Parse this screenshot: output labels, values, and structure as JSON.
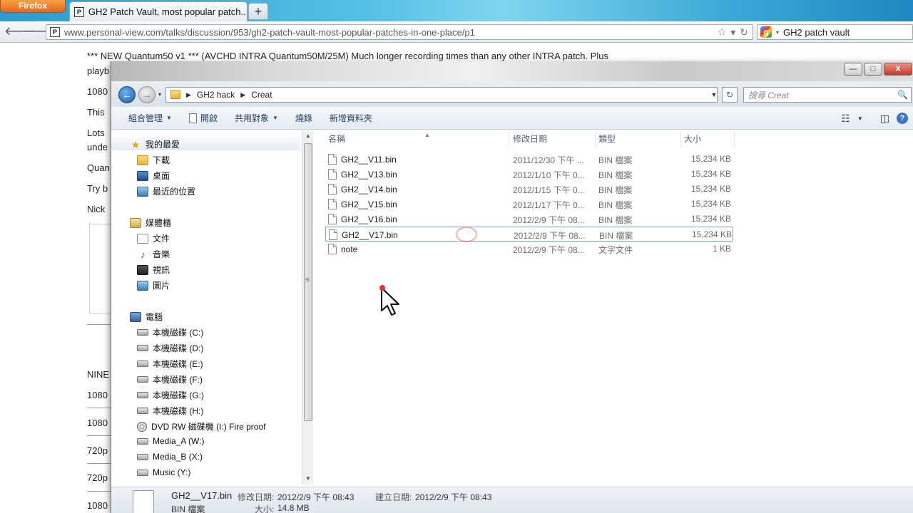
{
  "browser": {
    "menu_button": "Firefox",
    "tab_title": "GH2 Patch Vault, most popular patch...",
    "new_tab_label": "+",
    "url": "www.personal-view.com/talks/discussion/953/gh2-patch-vault-most-popular-patches-in-one-place/p1",
    "search_query": "GH2 patch vault",
    "back_icon": "arrow-left-icon",
    "forward_icon": "arrow-right-icon"
  },
  "webpage": {
    "lines": [
      "*** NEW Quantum50 v1 *** (AVCHD INTRA Quantum50M/25M) Much longer recording times than any other INTRA patch. Plus",
      "playb",
      "1080",
      "This",
      "Lots",
      "unde",
      "Quan",
      "Try b",
      "Nick",
      "NINE",
      "1080",
      "1080",
      "720p",
      "720p",
      "1080"
    ]
  },
  "explorer": {
    "window_buttons": {
      "minimize": "—",
      "maximize": "□",
      "close": "X"
    },
    "breadcrumb": [
      "GH2 hack",
      "Creat"
    ],
    "search_placeholder": "搜尋 Creat",
    "toolbar": {
      "organize": "組合管理",
      "open": "開啟",
      "share": "共用對象",
      "burn": "燒錄",
      "new_folder": "新增資料夾"
    },
    "nav": {
      "favorites": "我的最愛",
      "downloads": "下載",
      "desktop": "桌面",
      "recent": "最近的位置",
      "libraries": "媒體櫃",
      "documents": "文件",
      "music": "音樂",
      "videos": "視訊",
      "pictures": "圖片",
      "computer": "電腦",
      "drives": [
        "本機磁碟 (C:)",
        "本機磁碟 (D:)",
        "本機磁碟 (E:)",
        "本機磁碟 (F:)",
        "本機磁碟 (G:)",
        "本機磁碟 (H:)",
        "DVD RW 磁碟機 (I:) Fire proof",
        "Media_A (W:)",
        "Media_B (X:)",
        "Music (Y:)"
      ]
    },
    "columns": {
      "name": "名稱",
      "date": "修改日期",
      "type": "類型",
      "size": "大小"
    },
    "files": [
      {
        "name": "GH2__V11.bin",
        "date": "2011/12/30 下午 ...",
        "type": "BIN 檔案",
        "size": "15,234 KB"
      },
      {
        "name": "GH2__V13.bin",
        "date": "2012/1/10 下午 0...",
        "type": "BIN 檔案",
        "size": "15,234 KB"
      },
      {
        "name": "GH2__V14.bin",
        "date": "2012/1/15 下午 0...",
        "type": "BIN 檔案",
        "size": "15,234 KB"
      },
      {
        "name": "GH2__V15.bin",
        "date": "2012/1/17 下午 0...",
        "type": "BIN 檔案",
        "size": "15,234 KB"
      },
      {
        "name": "GH2__V16.bin",
        "date": "2012/2/9 下午 08...",
        "type": "BIN 檔案",
        "size": "15,234 KB"
      },
      {
        "name": "GH2__V17.bin",
        "date": "2012/2/9 下午 08...",
        "type": "BIN 檔案",
        "size": "15,234 KB"
      },
      {
        "name": "note",
        "date": "2012/2/9 下午 08...",
        "type": "文字文件",
        "size": "1 KB"
      }
    ],
    "selected_index": 5,
    "details": {
      "filename": "GH2__V17.bin",
      "modified_label": "修改日期:",
      "modified_value": "2012/2/9 下午 08:43",
      "created_label": "建立日期:",
      "created_value": "2012/2/9 下午 08:43",
      "type": "BIN 檔案",
      "size_label": "大小:",
      "size_value": "14.8 MB"
    }
  }
}
